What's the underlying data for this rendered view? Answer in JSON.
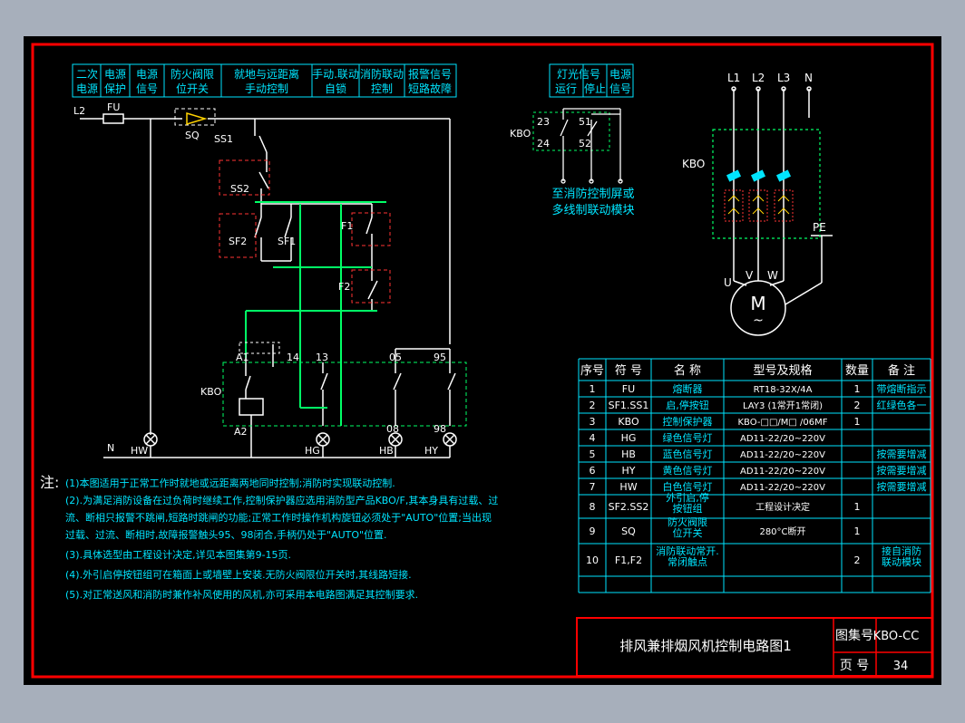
{
  "colors": {
    "frame": "#ff0000",
    "wire": "#ffffff",
    "control_wire": "#00ff66",
    "cyan_text": "#00e5ff",
    "dash_box": "#ff3333",
    "table_line": "#00e5ff",
    "accent": "#ffd200"
  },
  "header_cells": [
    {
      "line1": "二次",
      "line2": "电源"
    },
    {
      "line1": "电源",
      "line2": "保护"
    },
    {
      "line1": "电源",
      "line2": "信号"
    },
    {
      "line1": "防火阀限",
      "line2": "位开关"
    },
    {
      "line1": "就地与远距离",
      "line2": "手动控制"
    },
    {
      "line1": "手动.联动",
      "line2": "自锁"
    },
    {
      "line1": "消防联动",
      "line2": "控制"
    },
    {
      "line1": "报警信号",
      "line2": "短路故障"
    }
  ],
  "signal_header": [
    {
      "line1": "灯光信号",
      "line2": "运行"
    },
    {
      "line1": "",
      "line2": "停止"
    },
    {
      "line1": "电源",
      "line2": "信号"
    }
  ],
  "labels": {
    "l2": "L2",
    "fu": "FU",
    "sq": "SQ",
    "ss1": "SS1",
    "ss2": "SS2",
    "sf2": "SF2",
    "sf1": "SF1",
    "f1": "F1",
    "f2": "F2",
    "kbo_coil": "KBO",
    "a1": "A1",
    "a2": "A2",
    "t14": "14",
    "t13": "13",
    "t05": "05",
    "t95": "95",
    "t08": "08",
    "t98": "98",
    "n": "N",
    "hw": "HW",
    "hg": "HG",
    "hb": "HB",
    "hy": "HY",
    "kbo_mid": "KBO",
    "c23": "23",
    "c24": "24",
    "c51": "51",
    "c52": "52",
    "mid_note1": "至消防控制屏或",
    "mid_note2": "多线制联动模块",
    "p_l1": "L1",
    "p_l2": "L2",
    "p_l3": "L3",
    "p_n": "N",
    "p_kbo": "KBO",
    "pe": "PE",
    "u": "U",
    "v": "V",
    "w": "W",
    "motor": "M",
    "motor_sub": "~"
  },
  "notes": {
    "title": "注:",
    "lines": [
      "(1)本图适用于正常工作时就地或远距离两地同时控制;消防时实现联动控制.",
      "(2).为满足消防设备在过负荷时继续工作,控制保护器应选用消防型产品KBO/F,其本身具有过载、过",
      "流、断相只报警不跳闸,短路时跳闸的功能;正常工作时操作机构旋钮必须处于\"AUTO\"位置;当出现",
      "过载、过流、断相时,故障报警触头95、98闭合,手柄仍处于\"AUTO\"位置.",
      "(3).具体选型由工程设计决定,详见本图集第9-15页.",
      "(4).外引启停按钮组可在箱面上或墙壁上安装.无防火阀限位开关时,其线路短接.",
      "(5).对正常送风和消防时兼作补风使用的风机,亦可采用本电路图满足其控制要求."
    ]
  },
  "table": {
    "headers": [
      "序号",
      "符 号",
      "名 称",
      "型号及规格",
      "数量",
      "备 注"
    ],
    "rows": [
      [
        "1",
        "FU",
        "熔断器",
        "RT18-32X/4A",
        "1",
        "带熔断指示"
      ],
      [
        "2",
        "SF1.SS1",
        "启,停按钮",
        "LAY3  (1常开1常闭)",
        "2",
        "红绿色各一"
      ],
      [
        "3",
        "KBO",
        "控制保护器",
        "KBO-□□/M□ /06MF",
        "1",
        ""
      ],
      [
        "4",
        "HG",
        "绿色信号灯",
        "AD11-22/20~220V",
        "",
        ""
      ],
      [
        "5",
        "HB",
        "蓝色信号灯",
        "AD11-22/20~220V",
        "",
        "按需要增减"
      ],
      [
        "6",
        "HY",
        "黄色信号灯",
        "AD11-22/20~220V",
        "",
        "按需要增减"
      ],
      [
        "7",
        "HW",
        "白色信号灯",
        "AD11-22/20~220V",
        "",
        "按需要增减"
      ],
      [
        "8",
        "SF2.SS2",
        "外引启,停|按钮组",
        "工程设计决定",
        "1",
        ""
      ],
      [
        "9",
        "SQ",
        "防火阀限|位开关",
        "280°C断开",
        "1",
        ""
      ],
      [
        "10",
        "F1,F2",
        "消防联动常开.|常闭触点",
        "",
        "2",
        "接自消防|联动模块"
      ],
      [
        "",
        "",
        "",
        "",
        "",
        ""
      ]
    ]
  },
  "title_block": {
    "title": "排风兼排烟风机控制电路图1",
    "atlas_label": "图集号",
    "atlas_value": "KBO-CC",
    "page_label": "页 号",
    "page_value": "34"
  }
}
